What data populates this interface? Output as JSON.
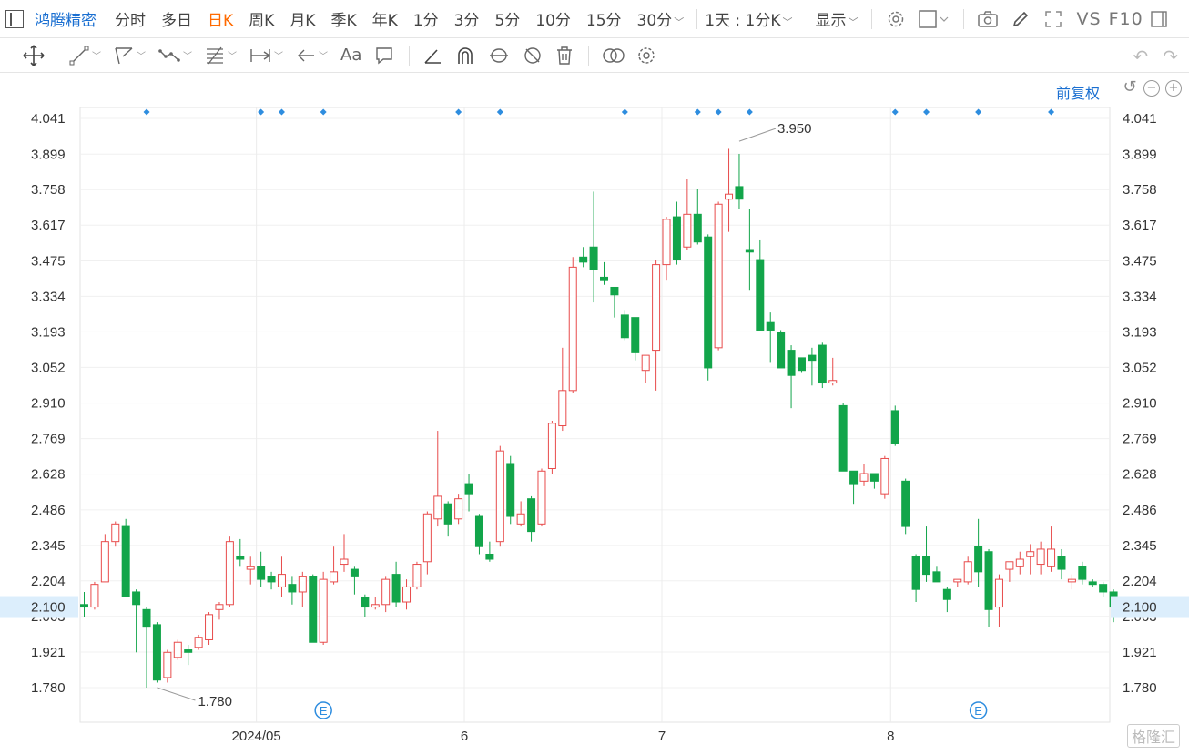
{
  "header": {
    "stock_name": "鸿腾精密",
    "timeframes": [
      "分时",
      "多日",
      "日K",
      "周K",
      "月K",
      "季K",
      "年K",
      "1分",
      "3分",
      "5分",
      "10分",
      "15分",
      "30分"
    ],
    "active_timeframe": "日K",
    "period_select": "1天 : 1分K",
    "display_label": "显示",
    "vs_label": "VS",
    "f10_label": "F10"
  },
  "toolbar": {
    "text_tool_label": "Aa"
  },
  "adjust_label": "前复权",
  "watermark": "格隆汇",
  "colors": {
    "up": "#e84b4b",
    "down": "#12a54a",
    "current_price": "#ff6a00",
    "current_price_bg": "#dceefc",
    "event_marker": "#2e8ddf",
    "accent": "#1a6fd1"
  },
  "chart_data": {
    "type": "candlestick",
    "y_ticks": [
      "4.041",
      "3.899",
      "3.758",
      "3.617",
      "3.475",
      "3.334",
      "3.193",
      "3.052",
      "2.910",
      "2.769",
      "2.628",
      "2.486",
      "2.345",
      "2.204",
      "2.063",
      "1.921",
      "1.780"
    ],
    "ylim": [
      1.78,
      4.041
    ],
    "x_labels": [
      {
        "label": "2024/05",
        "index": 17
      },
      {
        "label": "6",
        "index": 37
      },
      {
        "label": "7",
        "index": 56
      },
      {
        "label": "8",
        "index": 78
      }
    ],
    "current_price": "2.100",
    "max_label": {
      "value": "3.950",
      "index": 63
    },
    "min_label": {
      "value": "1.780",
      "index": 7
    },
    "event_markers": [
      6,
      17,
      19,
      23,
      36,
      40,
      52,
      59,
      61,
      64,
      78,
      81,
      86,
      93
    ],
    "earnings_markers": [
      23,
      86
    ],
    "earnings_label": "E",
    "candles": [
      [
        2.11,
        2.16,
        2.06,
        2.1
      ],
      [
        2.1,
        2.2,
        2.09,
        2.19
      ],
      [
        2.2,
        2.39,
        2.2,
        2.36
      ],
      [
        2.36,
        2.44,
        2.34,
        2.43
      ],
      [
        2.42,
        2.45,
        2.14,
        2.14
      ],
      [
        2.16,
        2.17,
        1.92,
        2.11
      ],
      [
        2.09,
        2.1,
        1.78,
        2.02
      ],
      [
        2.03,
        2.04,
        1.8,
        1.81
      ],
      [
        1.82,
        1.93,
        1.8,
        1.92
      ],
      [
        1.9,
        1.97,
        1.89,
        1.96
      ],
      [
        1.93,
        1.95,
        1.87,
        1.92
      ],
      [
        1.94,
        1.99,
        1.93,
        1.98
      ],
      [
        1.97,
        2.08,
        1.95,
        2.07
      ],
      [
        2.09,
        2.12,
        2.05,
        2.11
      ],
      [
        2.11,
        2.38,
        2.1,
        2.36
      ],
      [
        2.3,
        2.37,
        2.26,
        2.29
      ],
      [
        2.25,
        2.3,
        2.19,
        2.26
      ],
      [
        2.26,
        2.32,
        2.18,
        2.21
      ],
      [
        2.22,
        2.24,
        2.17,
        2.2
      ],
      [
        2.18,
        2.3,
        2.14,
        2.23
      ],
      [
        2.19,
        2.22,
        2.11,
        2.16
      ],
      [
        2.16,
        2.24,
        2.1,
        2.22
      ],
      [
        2.22,
        2.23,
        1.96,
        1.96
      ],
      [
        1.96,
        2.24,
        1.95,
        2.21
      ],
      [
        2.2,
        2.34,
        2.19,
        2.24
      ],
      [
        2.27,
        2.39,
        2.24,
        2.29
      ],
      [
        2.25,
        2.26,
        2.15,
        2.22
      ],
      [
        2.14,
        2.15,
        2.06,
        2.1
      ],
      [
        2.1,
        2.14,
        2.09,
        2.11
      ],
      [
        2.11,
        2.22,
        2.08,
        2.21
      ],
      [
        2.23,
        2.28,
        2.1,
        2.12
      ],
      [
        2.12,
        2.21,
        2.09,
        2.18
      ],
      [
        2.18,
        2.28,
        2.17,
        2.27
      ],
      [
        2.28,
        2.48,
        2.23,
        2.47
      ],
      [
        2.45,
        2.8,
        2.42,
        2.54
      ],
      [
        2.51,
        2.52,
        2.38,
        2.43
      ],
      [
        2.45,
        2.55,
        2.43,
        2.53
      ],
      [
        2.59,
        2.63,
        2.48,
        2.55
      ],
      [
        2.46,
        2.47,
        2.31,
        2.34
      ],
      [
        2.31,
        2.36,
        2.28,
        2.29
      ],
      [
        2.36,
        2.74,
        2.34,
        2.72
      ],
      [
        2.67,
        2.7,
        2.43,
        2.46
      ],
      [
        2.43,
        2.52,
        2.42,
        2.47
      ],
      [
        2.53,
        2.54,
        2.36,
        2.4
      ],
      [
        2.43,
        2.65,
        2.42,
        2.64
      ],
      [
        2.65,
        2.84,
        2.63,
        2.83
      ],
      [
        2.82,
        3.13,
        2.8,
        2.96
      ],
      [
        2.96,
        3.49,
        2.95,
        3.45
      ],
      [
        3.49,
        3.53,
        3.45,
        3.47
      ],
      [
        3.53,
        3.75,
        3.31,
        3.44
      ],
      [
        3.41,
        3.47,
        3.38,
        3.4
      ],
      [
        3.37,
        3.36,
        3.25,
        3.34
      ],
      [
        3.26,
        3.28,
        3.16,
        3.17
      ],
      [
        3.25,
        3.25,
        3.08,
        3.11
      ],
      [
        3.04,
        3.07,
        2.99,
        3.1
      ],
      [
        3.12,
        3.48,
        2.96,
        3.46
      ],
      [
        3.46,
        3.65,
        3.4,
        3.64
      ],
      [
        3.65,
        3.71,
        3.46,
        3.48
      ],
      [
        3.53,
        3.8,
        3.52,
        3.66
      ],
      [
        3.66,
        3.76,
        3.54,
        3.55
      ],
      [
        3.57,
        3.58,
        3.0,
        3.05
      ],
      [
        3.13,
        3.71,
        3.12,
        3.7
      ],
      [
        3.72,
        3.92,
        3.59,
        3.74
      ],
      [
        3.77,
        3.9,
        3.68,
        3.72
      ],
      [
        3.52,
        3.68,
        3.36,
        3.51
      ],
      [
        3.48,
        3.56,
        3.21,
        3.2
      ],
      [
        3.23,
        3.27,
        3.07,
        3.2
      ],
      [
        3.19,
        3.2,
        3.06,
        3.05
      ],
      [
        3.12,
        3.14,
        2.89,
        3.02
      ],
      [
        3.09,
        3.09,
        3.03,
        3.04
      ],
      [
        3.1,
        3.13,
        2.98,
        3.08
      ],
      [
        3.14,
        3.15,
        2.97,
        2.99
      ],
      [
        2.99,
        3.09,
        2.98,
        3.0
      ],
      [
        2.9,
        2.91,
        2.64,
        2.64
      ],
      [
        2.64,
        2.64,
        2.51,
        2.59
      ],
      [
        2.6,
        2.67,
        2.58,
        2.63
      ],
      [
        2.63,
        2.63,
        2.57,
        2.6
      ],
      [
        2.55,
        2.7,
        2.53,
        2.69
      ],
      [
        2.88,
        2.9,
        2.74,
        2.75
      ],
      [
        2.6,
        2.61,
        2.39,
        2.42
      ],
      [
        2.3,
        2.31,
        2.12,
        2.17
      ],
      [
        2.3,
        2.42,
        2.2,
        2.23
      ],
      [
        2.24,
        2.26,
        2.2,
        2.2
      ],
      [
        2.17,
        2.18,
        2.08,
        2.13
      ],
      [
        2.2,
        2.21,
        2.18,
        2.21
      ],
      [
        2.2,
        2.3,
        2.19,
        2.28
      ],
      [
        2.34,
        2.45,
        2.18,
        2.24
      ],
      [
        2.32,
        2.33,
        2.02,
        2.09
      ],
      [
        2.1,
        2.23,
        2.02,
        2.21
      ],
      [
        2.25,
        2.27,
        2.2,
        2.28
      ],
      [
        2.26,
        2.32,
        2.23,
        2.29
      ],
      [
        2.3,
        2.35,
        2.23,
        2.32
      ],
      [
        2.27,
        2.36,
        2.23,
        2.33
      ],
      [
        2.26,
        2.42,
        2.24,
        2.33
      ],
      [
        2.3,
        2.33,
        2.21,
        2.25
      ],
      [
        2.2,
        2.23,
        2.17,
        2.21
      ],
      [
        2.26,
        2.28,
        2.19,
        2.21
      ],
      [
        2.2,
        2.21,
        2.18,
        2.19
      ],
      [
        2.19,
        2.2,
        2.14,
        2.16
      ],
      [
        2.16,
        2.17,
        2.04,
        2.1
      ]
    ]
  }
}
